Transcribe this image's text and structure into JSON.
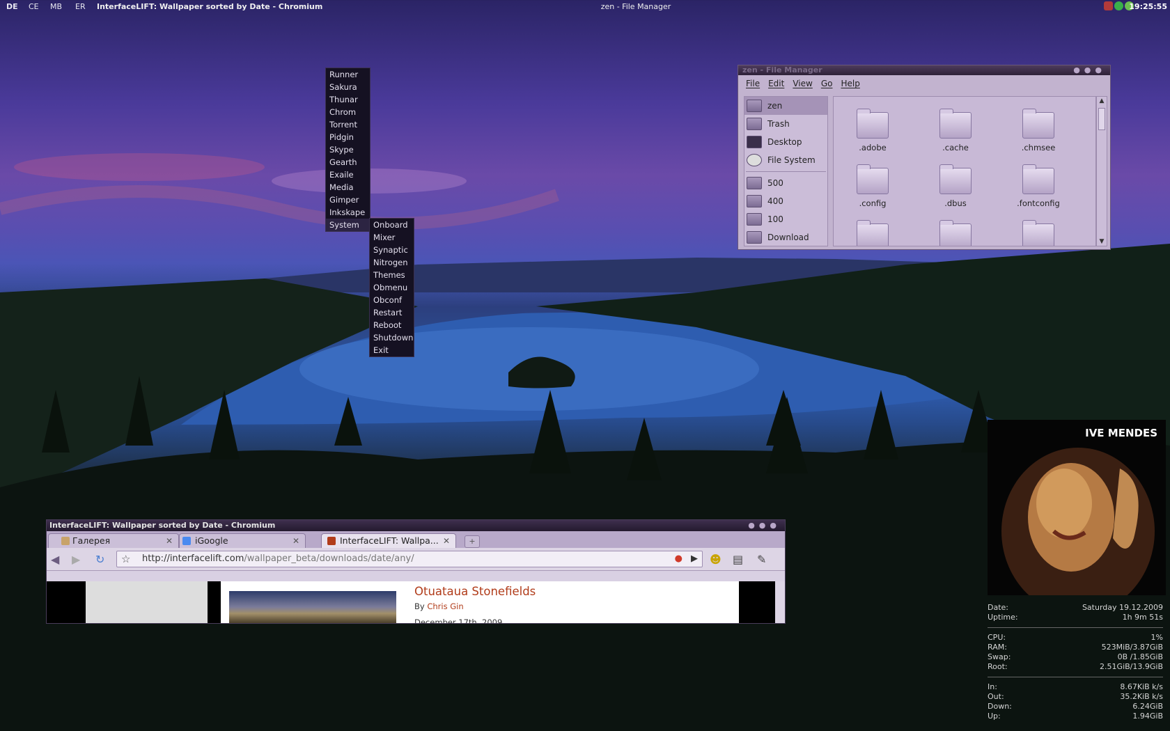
{
  "top_panel": {
    "workspaces": [
      "DE",
      "CE",
      "MB",
      "ER"
    ],
    "active_window_title": "InterfaceLIFT: Wallpaper sorted by Date - Chromium",
    "center_title": "zen - File Manager",
    "clock": "19:25:55"
  },
  "app_menu": {
    "items": [
      "Runner",
      "Sakura",
      "Thunar",
      "Chrom",
      "Torrent",
      "Pidgin",
      "Skype",
      "Gearth",
      "Exaile",
      "Media",
      "Gimper",
      "Inkskape",
      "System"
    ],
    "active": "System"
  },
  "system_menu": {
    "items": [
      "Onboard",
      "Mixer",
      "Synaptic",
      "Nitrogen",
      "Themes",
      "Obmenu",
      "Obconf",
      "Restart",
      "Reboot",
      "Shutdown",
      "Exit"
    ]
  },
  "file_manager": {
    "title": "zen - File Manager",
    "menu": [
      "File",
      "Edit",
      "View",
      "Go",
      "Help"
    ],
    "places": [
      "zen",
      "Trash",
      "Desktop",
      "File System"
    ],
    "bookmarks": [
      "500",
      "400",
      "100",
      "Download"
    ],
    "folders": [
      ".adobe",
      ".cache",
      ".chmsee",
      ".config",
      ".dbus",
      ".fontconfig",
      "",
      "",
      ""
    ]
  },
  "browser": {
    "title": "InterfaceLIFT: Wallpaper sorted by Date - Chromium",
    "tabs": [
      {
        "label": "Галерея",
        "favicon_color": "#c8a36a"
      },
      {
        "label": "iGoogle",
        "favicon_color": "#4a8af0"
      },
      {
        "label": "InterfaceLIFT: Wallpa...",
        "favicon_color": "#b13c1a"
      }
    ],
    "url_host": "http://interfacelift.com",
    "url_path": "/wallpaper_beta/downloads/date/any/",
    "page": {
      "title": "Otuataua Stonefields",
      "by": "By",
      "author": "Chris Gin",
      "date": "December 17th, 2009"
    }
  },
  "conky": {
    "photo_caption": "IVE MENDES",
    "date_label": "Date:",
    "date_value": "Saturday   19.12.2009",
    "uptime_label": "Uptime:",
    "uptime_value": "1h 9m 51s",
    "cpu_label": "CPU:",
    "cpu_value": "1%",
    "ram_label": "RAM:",
    "ram_value": "523MiB/3.87GiB",
    "swap_label": "Swap:",
    "swap_value": "0B  /1.85GiB",
    "root_label": "Root:",
    "root_value": "2.51GiB/13.9GiB",
    "in_label": "In:",
    "in_value": "8.67KiB k/s",
    "out_label": "Out:",
    "out_value": "35.2KiB k/s",
    "down_label": "Down:",
    "down_value": "6.24GiB",
    "up_label": "Up:",
    "up_value": "1.94GiB"
  },
  "colors": {
    "menu_bg": "#151122",
    "fm_bg": "#c2b3cf",
    "accent_link": "#b13c1a"
  }
}
